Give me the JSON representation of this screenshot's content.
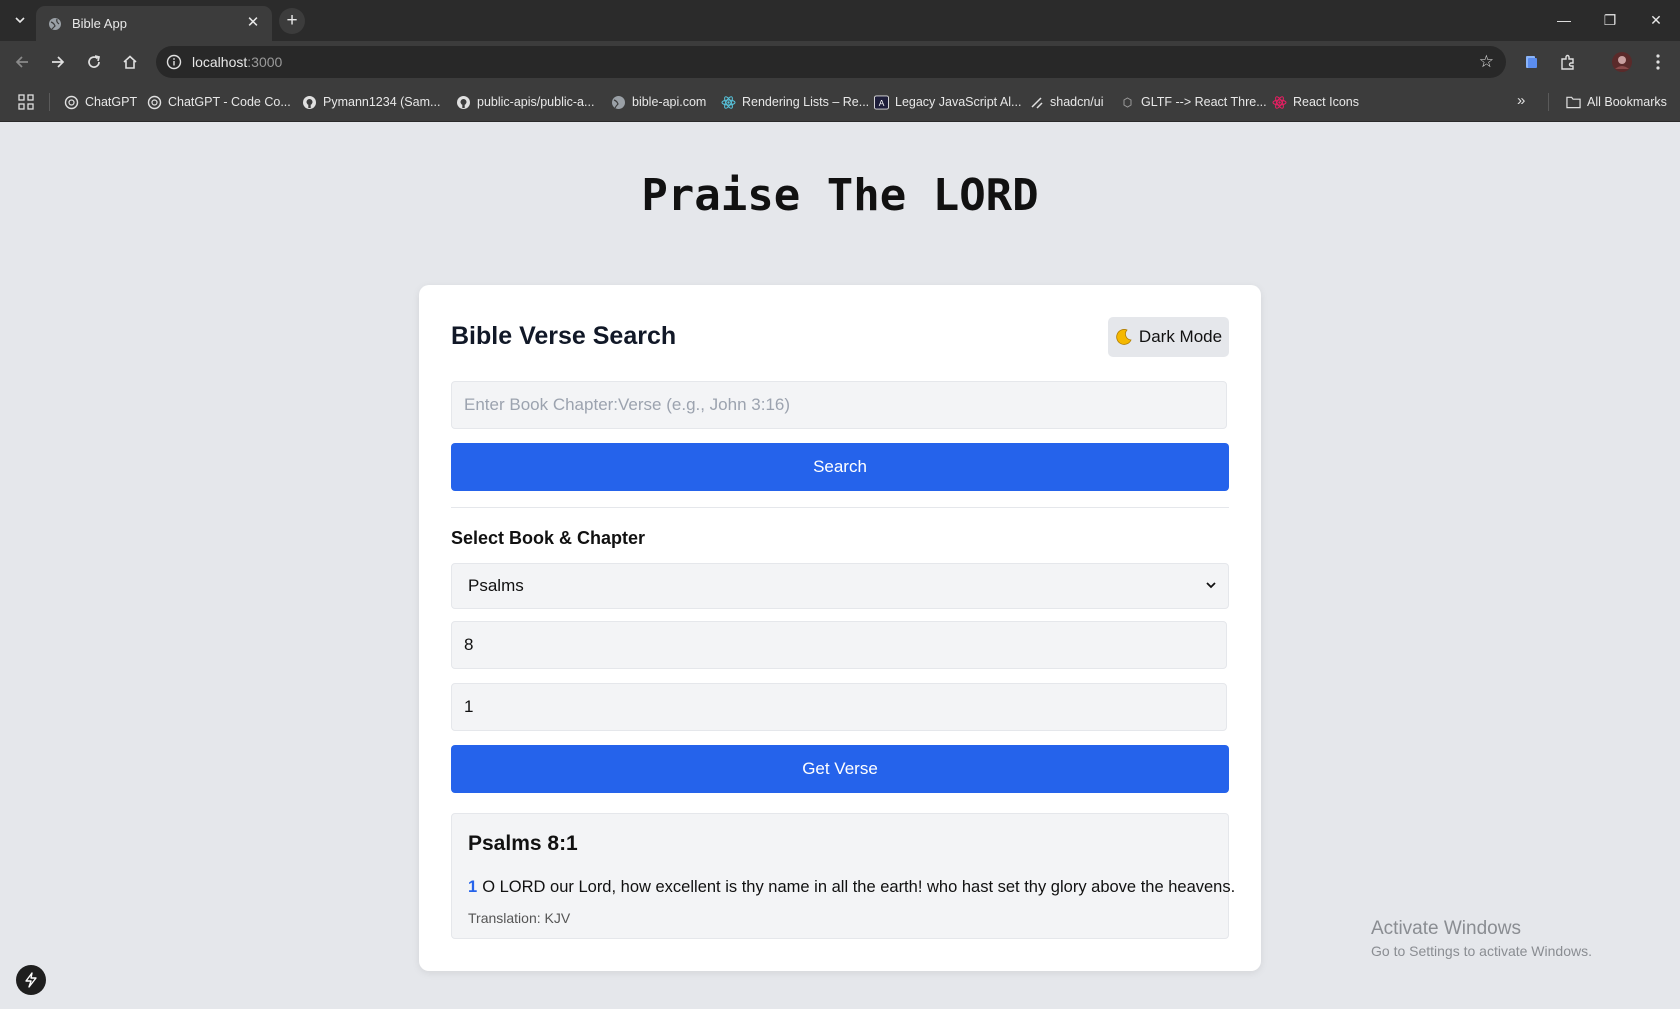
{
  "browser": {
    "tab_title": "Bible App",
    "url_host": "localhost",
    "url_port": ":3000",
    "bookmarks": [
      {
        "label": "ChatGPT",
        "icon": "openai-icon"
      },
      {
        "label": "ChatGPT - Code Co...",
        "icon": "openai-icon"
      },
      {
        "label": "Pymann1234 (Sam...",
        "icon": "github-icon"
      },
      {
        "label": "public-apis/public-a...",
        "icon": "github-icon"
      },
      {
        "label": "bible-api.com",
        "icon": "globe-icon"
      },
      {
        "label": "Rendering Lists – Re...",
        "icon": "react-icon"
      },
      {
        "label": "Legacy JavaScript Al...",
        "icon": "a-logo-icon"
      },
      {
        "label": "shadcn/ui",
        "icon": "shadcn-icon"
      },
      {
        "label": "GLTF --> React Thre...",
        "icon": "cube-icon"
      },
      {
        "label": "React Icons",
        "icon": "react-icons-icon"
      }
    ],
    "all_bookmarks": "All Bookmarks"
  },
  "page": {
    "heading": "Praise The LORD"
  },
  "card": {
    "title": "Bible Verse Search",
    "dark_mode_label": "Dark Mode",
    "dark_mode_icon": "moon-icon",
    "search_placeholder": "Enter Book Chapter:Verse (e.g., John 3:16)",
    "search_button": "Search",
    "select_label": "Select Book & Chapter",
    "book_selected": "Psalms",
    "chapter_value": "8",
    "verse_value": "1",
    "get_verse_button": "Get Verse",
    "result": {
      "reference": "Psalms 8:1",
      "verse_number": "1",
      "verse_text": "O LORD our Lord, how excellent is thy name in all the earth! who hast set thy glory above the heavens.",
      "translation": "Translation: KJV"
    }
  },
  "watermark": {
    "line1": "Activate Windows",
    "line2": "Go to Settings to activate Windows."
  },
  "colors": {
    "accent": "#2563eb",
    "page_bg": "#e5e7eb",
    "card_bg": "#ffffff"
  }
}
